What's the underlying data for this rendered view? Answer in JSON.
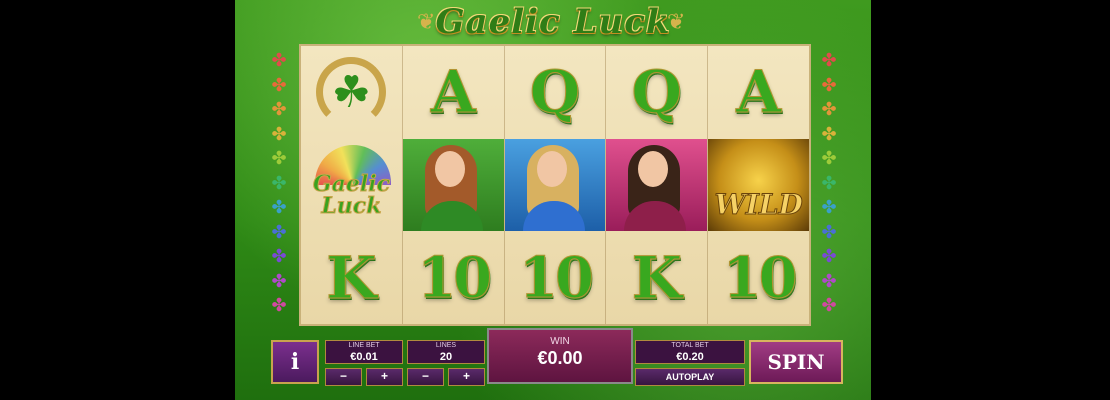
{
  "game": {
    "title": "Gaelic Luck",
    "logo_text_line1": "Gaelic",
    "logo_text_line2": "Luck",
    "wild_text": "WILD"
  },
  "reels": [
    [
      "horseshoe-clover",
      "gaelic-luck-logo",
      "K"
    ],
    [
      "A",
      "leprechaun-girl",
      "10"
    ],
    [
      "Q",
      "blue-dress-girl",
      "10"
    ],
    [
      "Q",
      "pink-dress-girl",
      "K"
    ],
    [
      "A",
      "pot-of-gold-wild",
      "10"
    ]
  ],
  "letters": {
    "r0c2": "K",
    "r1c0": "A",
    "r1c2": "10",
    "r2c0": "Q",
    "r2c2": "10",
    "r3c0": "Q",
    "r3c2": "K",
    "r4c0": "A",
    "r4c2": "10"
  },
  "controls": {
    "info_label": "i",
    "line_bet_label": "LINE BET",
    "line_bet_value": "€0.01",
    "lines_label": "LINES",
    "lines_value": "20",
    "minus": "−",
    "plus": "+",
    "win_label": "WIN",
    "win_value": "€0.00",
    "total_bet_label": "TOTAL BET",
    "total_bet_value": "€0.20",
    "autoplay_label": "AUTOPLAY",
    "spin_label": "SPIN"
  },
  "colors": {
    "accent_green": "#39a81f",
    "gold": "#c9a54a",
    "purple": "#6d1a57"
  }
}
